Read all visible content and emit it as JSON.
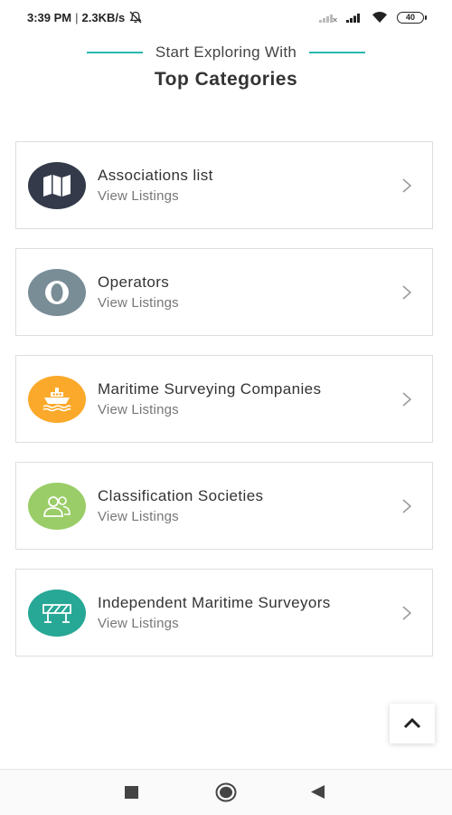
{
  "status_bar": {
    "time": "3:39 PM",
    "separator": "|",
    "speed": "2.3KB/s",
    "battery": "40"
  },
  "header": {
    "subtitle": "Start Exploring With",
    "title": "Top Categories",
    "accent_color": "#29b8b0"
  },
  "categories": [
    {
      "name": "Associations list",
      "sub": "View Listings",
      "icon": "map-icon",
      "color": "#343a4a"
    },
    {
      "name": "Operators",
      "sub": "View Listings",
      "icon": "opera-ring-icon",
      "color": "#798d97"
    },
    {
      "name": "Maritime Surveying Companies",
      "sub": "View Listings",
      "icon": "ship-icon",
      "color": "#fba92a"
    },
    {
      "name": "Classification Societies",
      "sub": "View Listings",
      "icon": "users-icon",
      "color": "#9acd67"
    },
    {
      "name": "Independent Maritime Surveyors",
      "sub": "View Listings",
      "icon": "barrier-icon",
      "color": "#27a796"
    }
  ]
}
